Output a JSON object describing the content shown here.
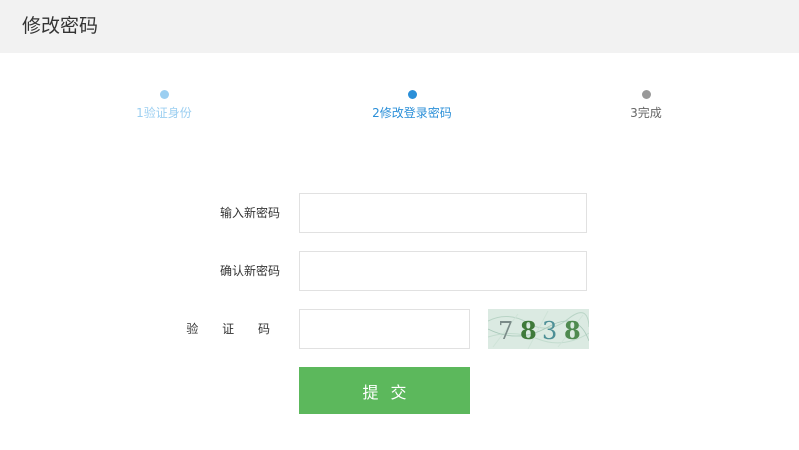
{
  "header": {
    "title": "修改密码"
  },
  "steps": [
    {
      "label": "1验证身份",
      "color": "#9ccff1",
      "dot": "#9ccff1"
    },
    {
      "label": "2修改登录密码",
      "color": "#2b8fd8",
      "dot": "#2b8fd8"
    },
    {
      "label": "3完成",
      "color": "#666666",
      "dot": "#999999"
    }
  ],
  "form": {
    "new_password_label": "输入新密码",
    "new_password_value": "",
    "confirm_password_label": "确认新密码",
    "confirm_password_value": "",
    "captcha_label": "验 证 码",
    "captcha_value": "",
    "captcha_image_text": "7838",
    "submit_label": "提交"
  },
  "colors": {
    "submit": "#5cb85c",
    "active_step": "#2b8fd8"
  }
}
